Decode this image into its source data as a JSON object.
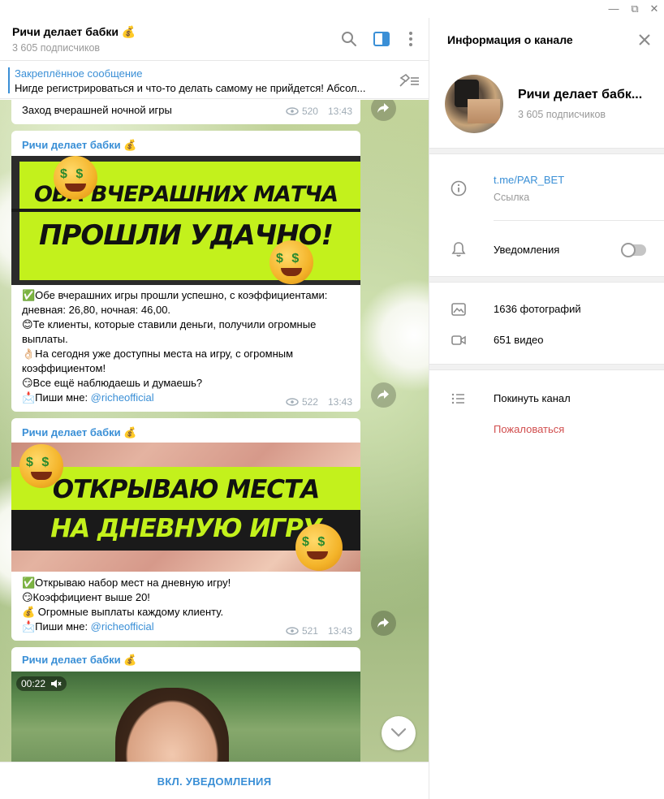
{
  "window": {
    "minimize": "—",
    "restore": "⧉",
    "close": "✕"
  },
  "chat": {
    "title": "Ричи делает бабки 💰",
    "subscribers": "3 605 подписчиков"
  },
  "pinned": {
    "label": "Закреплённое сообщение",
    "text": "Нигде регистрироваться и что-то делать самому не прийдется! Абсол..."
  },
  "messages": [
    {
      "text": "Заход вчерашней ночной игры",
      "views": "520",
      "time": "13:43"
    },
    {
      "author": "Ричи делает бабки 💰",
      "banner_lines": [
        "ОБА ВЧЕРАШНИХ МАТЧА",
        "ПРОШЛИ УДАЧНО!"
      ],
      "lines": [
        "✅Обе вчерашних игры прошли успешно, с коэффициентами:",
        "дневная: 26,80, ночная: 46,00.",
        "😊Те клиенты, которые ставили деньги, получили огромные",
        "выплаты.",
        "👌🏻На сегодня уже доступны места на игру, с огромным",
        "коэффициентом!",
        "😏Все ещё наблюдаешь и думаешь?",
        "📩Пиши мне: "
      ],
      "mention": "@richeofficial",
      "views": "522",
      "time": "13:43"
    },
    {
      "author": "Ричи делает бабки 💰",
      "banner_lines": [
        "ОТКРЫВАЮ МЕСТА",
        "НА ДНЕВНУЮ ИГРУ"
      ],
      "lines": [
        "✅Открываю набор мест на дневную игру!",
        "😏Коэффициент выше 20!",
        "💰 Огромные выплаты каждому клиенту.",
        "📩Пиши мне: "
      ],
      "mention": "@richeofficial",
      "views": "521",
      "time": "13:43"
    },
    {
      "author": "Ричи делает бабки 💰",
      "video_time": "00:22"
    }
  ],
  "footer": {
    "button": "ВКЛ. УВЕДОМЛЕНИЯ"
  },
  "info": {
    "title": "Информация о канале",
    "name": "Ричи делает бабк...",
    "subscribers": "3 605 подписчиков",
    "link": "t.me/PAR_BET",
    "link_hint": "Ссылка",
    "notifications": "Уведомления",
    "notifications_on": false,
    "photos": "1636 фотографий",
    "videos": "651 видео",
    "leave": "Покинуть канал",
    "report": "Пожаловаться"
  },
  "colors": {
    "accent": "#3a8fd6",
    "lime": "#c3f11c",
    "danger": "#d14e4e"
  },
  "icons": [
    "search-icon",
    "sidebar-icon",
    "more-icon",
    "unpin-icon",
    "eye-icon",
    "share-icon",
    "chevron-down-icon",
    "close-icon",
    "info-icon",
    "bell-icon",
    "photo-icon",
    "video-icon",
    "list-icon",
    "mute-icon"
  ]
}
